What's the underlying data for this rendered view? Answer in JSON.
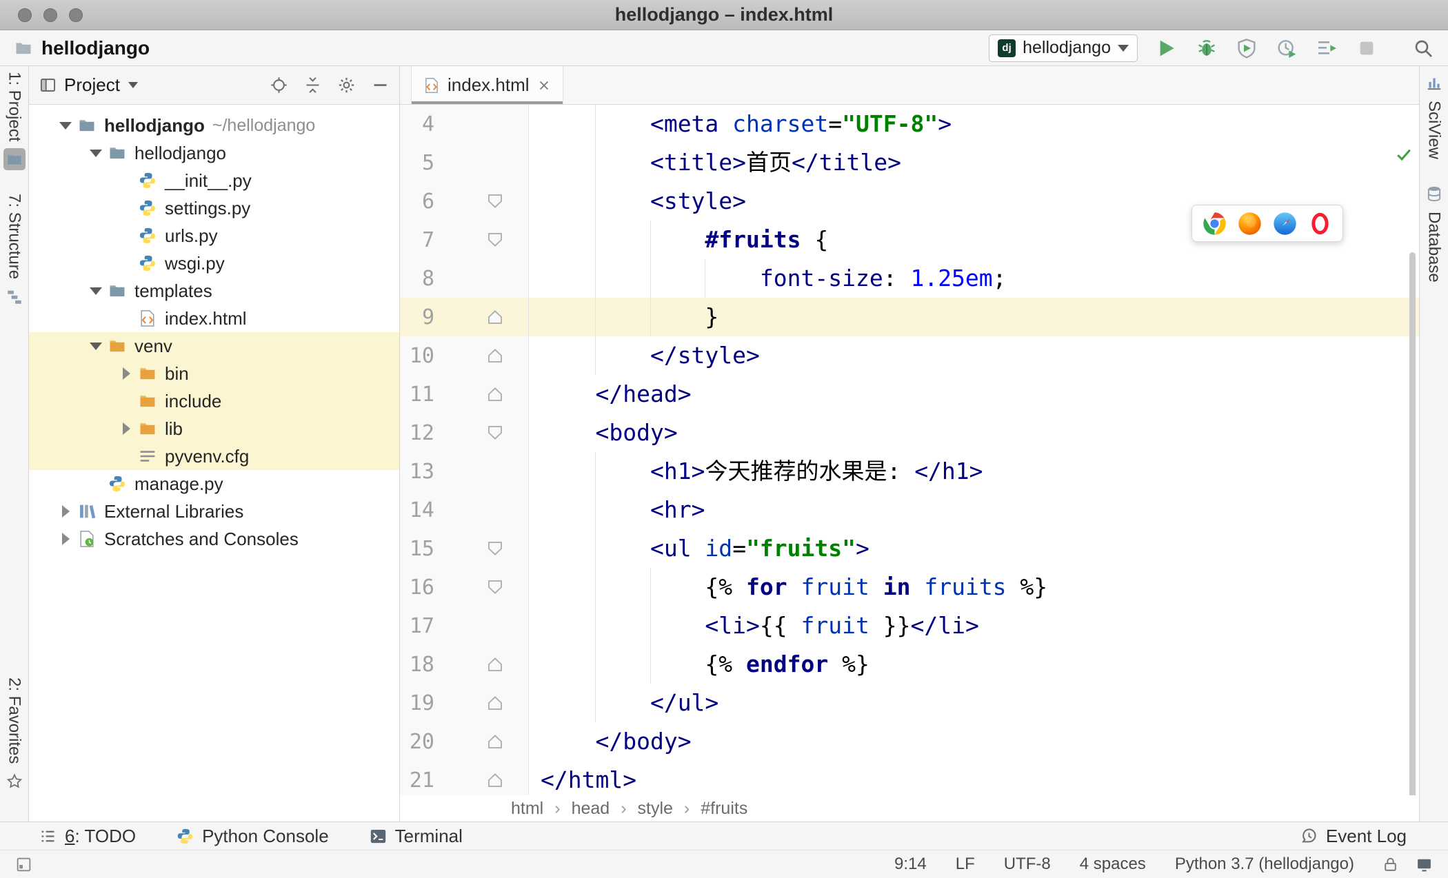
{
  "window": {
    "title": "hellodjango – index.html"
  },
  "toolbar": {
    "project": "hellodjango",
    "run_config": {
      "label": "hellodjango",
      "badge": "dj"
    },
    "actions": [
      {
        "id": "run",
        "icon": "run"
      },
      {
        "id": "debug",
        "icon": "debug"
      },
      {
        "id": "run-with-coverage",
        "icon": "coverage"
      },
      {
        "id": "profiler",
        "icon": "profiler"
      },
      {
        "id": "concurrency-diagram",
        "icon": "concurrency"
      },
      {
        "id": "stop",
        "icon": "stop"
      }
    ]
  },
  "strips": {
    "left_top": [
      {
        "id": "project",
        "label": "1: Project",
        "icon": "folder",
        "active": true
      },
      {
        "id": "structure",
        "label": "7: Structure",
        "icon": "structure"
      }
    ],
    "left_bottom": [
      {
        "id": "favorites",
        "label": "2: Favorites",
        "icon": "star"
      }
    ],
    "right": [
      {
        "id": "sciview",
        "label": "SciView",
        "icon": "sciview"
      },
      {
        "id": "database",
        "label": "Database",
        "icon": "database"
      }
    ]
  },
  "project_panel": {
    "title": "Project",
    "header_icons": [
      "locate",
      "collapse",
      "gear",
      "hide"
    ],
    "tree": [
      {
        "label": "hellodjango",
        "sub": "~/hellodjango",
        "icon": "folder",
        "indent": 0,
        "chevron": "down",
        "bold": true
      },
      {
        "label": "hellodjango",
        "icon": "folder",
        "indent": 1,
        "chevron": "down"
      },
      {
        "label": "__init__.py",
        "icon": "python",
        "indent": 2
      },
      {
        "label": "settings.py",
        "icon": "python",
        "indent": 2
      },
      {
        "label": "urls.py",
        "icon": "python",
        "indent": 2
      },
      {
        "label": "wsgi.py",
        "icon": "python",
        "indent": 2
      },
      {
        "label": "templates",
        "icon": "folder",
        "indent": 1,
        "chevron": "down"
      },
      {
        "label": "index.html",
        "icon": "html",
        "indent": 2
      },
      {
        "label": "venv",
        "icon": "folder-ex",
        "indent": 1,
        "chevron": "down",
        "highlight": true
      },
      {
        "label": "bin",
        "icon": "folder-ex",
        "indent": 2,
        "chevron": "right",
        "highlight": true
      },
      {
        "label": "include",
        "icon": "folder-ex",
        "indent": 2,
        "highlight": true
      },
      {
        "label": "lib",
        "icon": "folder-ex",
        "indent": 2,
        "chevron": "right",
        "highlight": true
      },
      {
        "label": "pyvenv.cfg",
        "icon": "config",
        "indent": 2,
        "highlight": true
      },
      {
        "label": "manage.py",
        "icon": "python",
        "indent": 1
      },
      {
        "label": "External Libraries",
        "icon": "libraries",
        "indent": 0,
        "chevron": "right"
      },
      {
        "label": "Scratches and Consoles",
        "icon": "scratches",
        "indent": 0,
        "chevron": "right"
      }
    ]
  },
  "editor": {
    "tab": {
      "title": "index.html"
    },
    "breadcrumbs": [
      "html",
      "head",
      "style",
      "#fruits"
    ],
    "browser_bar": [
      "chrome",
      "firefox",
      "safari",
      "opera"
    ],
    "lines": [
      {
        "num": 4,
        "indent": 8,
        "fold": null,
        "tokens": [
          {
            "t": "<meta ",
            "c": "tag"
          },
          {
            "t": "charset",
            "c": "attr"
          },
          {
            "t": "=",
            "c": "txt"
          },
          {
            "t": "\"UTF-8\"",
            "c": "str"
          },
          {
            "t": ">",
            "c": "tag"
          }
        ]
      },
      {
        "num": 5,
        "indent": 8,
        "fold": null,
        "tokens": [
          {
            "t": "<title>",
            "c": "tag"
          },
          {
            "t": "首页",
            "c": "txt"
          },
          {
            "t": "</title>",
            "c": "tag"
          }
        ]
      },
      {
        "num": 6,
        "indent": 8,
        "fold": "down",
        "tokens": [
          {
            "t": "<style>",
            "c": "tag"
          }
        ]
      },
      {
        "num": 7,
        "indent": 12,
        "fold": "down",
        "tokens": [
          {
            "t": "#fruits ",
            "c": "sel"
          },
          {
            "t": "{",
            "c": "txt"
          }
        ]
      },
      {
        "num": 8,
        "indent": 16,
        "fold": null,
        "tokens": [
          {
            "t": "font-size",
            "c": "prop"
          },
          {
            "t": ": ",
            "c": "txt"
          },
          {
            "t": "1.25em",
            "c": "num"
          },
          {
            "t": ";",
            "c": "txt"
          }
        ]
      },
      {
        "num": 9,
        "indent": 12,
        "fold": "up",
        "current": true,
        "tokens": [
          {
            "t": "}",
            "c": "txt"
          }
        ]
      },
      {
        "num": 10,
        "indent": 8,
        "fold": "up",
        "tokens": [
          {
            "t": "</style>",
            "c": "tag"
          }
        ]
      },
      {
        "num": 11,
        "indent": 4,
        "fold": "up",
        "tokens": [
          {
            "t": "</head>",
            "c": "tag"
          }
        ]
      },
      {
        "num": 12,
        "indent": 4,
        "fold": "down",
        "tokens": [
          {
            "t": "<body>",
            "c": "tag"
          }
        ]
      },
      {
        "num": 13,
        "indent": 8,
        "fold": null,
        "tokens": [
          {
            "t": "<h1>",
            "c": "tag"
          },
          {
            "t": "今天推荐的水果是: ",
            "c": "txt"
          },
          {
            "t": "</h1>",
            "c": "tag"
          }
        ]
      },
      {
        "num": 14,
        "indent": 8,
        "fold": null,
        "tokens": [
          {
            "t": "<hr>",
            "c": "tag"
          }
        ]
      },
      {
        "num": 15,
        "indent": 8,
        "fold": "down",
        "tokens": [
          {
            "t": "<ul ",
            "c": "tag"
          },
          {
            "t": "id",
            "c": "attr"
          },
          {
            "t": "=",
            "c": "txt"
          },
          {
            "t": "\"fruits\"",
            "c": "str"
          },
          {
            "t": ">",
            "c": "tag"
          }
        ]
      },
      {
        "num": 16,
        "indent": 12,
        "fold": "down",
        "tokens": [
          {
            "t": "{% ",
            "c": "txt"
          },
          {
            "t": "for ",
            "c": "kw"
          },
          {
            "t": "fruit ",
            "c": "var"
          },
          {
            "t": "in ",
            "c": "kw"
          },
          {
            "t": "fruits ",
            "c": "var"
          },
          {
            "t": "%}",
            "c": "txt"
          }
        ]
      },
      {
        "num": 17,
        "indent": 12,
        "fold": null,
        "tokens": [
          {
            "t": "<li>",
            "c": "tag"
          },
          {
            "t": "{{ ",
            "c": "txt"
          },
          {
            "t": "fruit ",
            "c": "var"
          },
          {
            "t": "}}",
            "c": "txt"
          },
          {
            "t": "</li>",
            "c": "tag"
          }
        ]
      },
      {
        "num": 18,
        "indent": 12,
        "fold": "up",
        "tokens": [
          {
            "t": "{% ",
            "c": "txt"
          },
          {
            "t": "endfor ",
            "c": "kw"
          },
          {
            "t": "%}",
            "c": "txt"
          }
        ]
      },
      {
        "num": 19,
        "indent": 8,
        "fold": "up",
        "tokens": [
          {
            "t": "</ul>",
            "c": "tag"
          }
        ]
      },
      {
        "num": 20,
        "indent": 4,
        "fold": "up",
        "tokens": [
          {
            "t": "</body>",
            "c": "tag"
          }
        ]
      },
      {
        "num": 21,
        "indent": 0,
        "fold": "up",
        "tokens": [
          {
            "t": "</html>",
            "c": "tag"
          }
        ]
      }
    ]
  },
  "bottom_bar": {
    "left": [
      {
        "id": "todo",
        "label": "6: TODO",
        "icon": "todo-list",
        "mnemonic": true
      },
      {
        "id": "python-console",
        "label": "Python Console",
        "icon": "python"
      },
      {
        "id": "terminal",
        "label": "Terminal",
        "icon": "terminal"
      }
    ],
    "right": [
      {
        "id": "event-log",
        "label": "Event Log",
        "icon": "event-log"
      }
    ]
  },
  "status_bar": {
    "items": [
      {
        "id": "cursor-position",
        "label": "9:14"
      },
      {
        "id": "line-separator",
        "label": "LF"
      },
      {
        "id": "encoding",
        "label": "UTF-8"
      },
      {
        "id": "indent",
        "label": "4 spaces"
      },
      {
        "id": "interpreter",
        "label": "Python 3.7 (hellodjango)"
      }
    ]
  },
  "colors": {
    "current_line": "#fbf6da",
    "excluded_highlight": "#fbf5d2",
    "tag": "#000080",
    "string": "#008000",
    "run_green": "#59a869",
    "tab_underline": "#9b9b9b"
  }
}
